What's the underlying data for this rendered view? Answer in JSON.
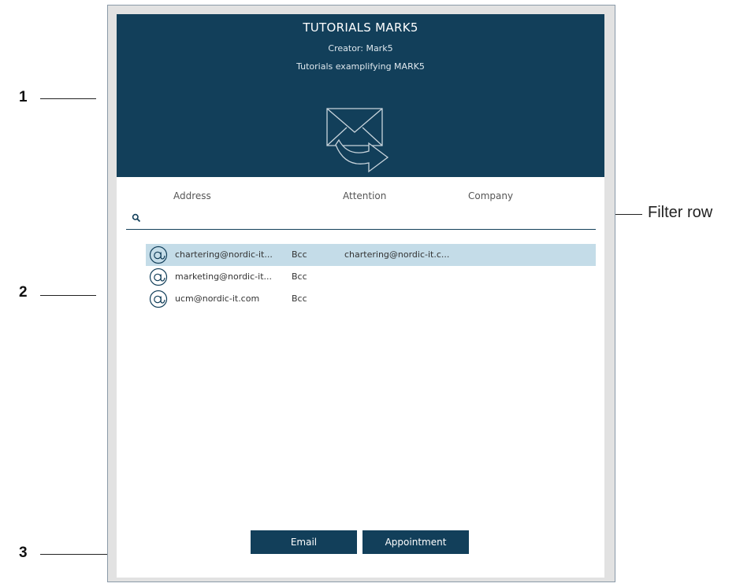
{
  "callouts": [
    {
      "label": "1"
    },
    {
      "label": "2"
    },
    {
      "label": "3"
    }
  ],
  "filter_row_label": "Filter row",
  "header": {
    "title": "TUTORIALS MARK5",
    "creator": "Creator: Mark5",
    "description": "Tutorials examplifying MARK5",
    "icon": "mail-forward-icon"
  },
  "columns": {
    "address": "Address",
    "attention": "Attention",
    "company": "Company"
  },
  "filter": {
    "value": "",
    "placeholder": ""
  },
  "rows": [
    {
      "address": "chartering@nordic-it...",
      "type": "Bcc",
      "attention": "chartering@nordic-it.c...",
      "company": "",
      "selected": true
    },
    {
      "address": "marketing@nordic-it...",
      "type": "Bcc",
      "attention": "",
      "company": "",
      "selected": false
    },
    {
      "address": "ucm@nordic-it.com",
      "type": "Bcc",
      "attention": "",
      "company": "",
      "selected": false
    }
  ],
  "buttons": {
    "email": "Email",
    "appointment": "Appointment"
  },
  "colors": {
    "header_bg": "#123f5a",
    "selected_row": "#c4dce8",
    "frame": "#e2e2e2"
  }
}
